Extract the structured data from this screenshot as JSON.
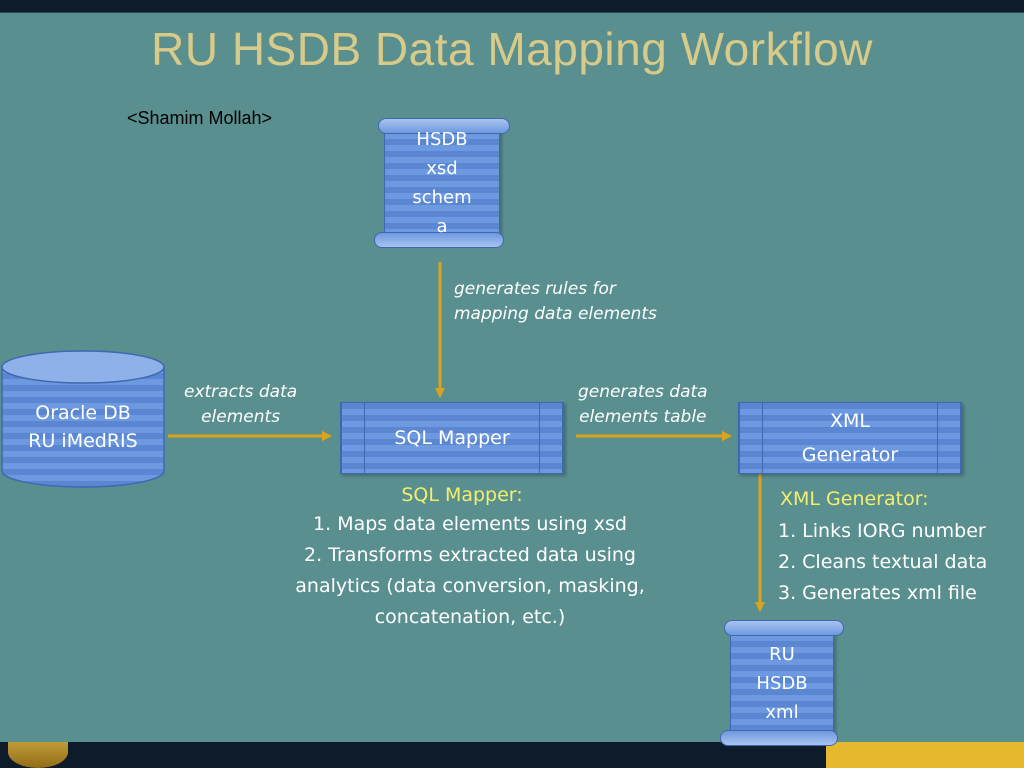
{
  "slide": {
    "title": "RU HSDB Data Mapping Workflow",
    "author": "<Shamim Mollah>"
  },
  "nodes": {
    "xsd_schema": {
      "label": "HSDB\nxsd\nschem\na"
    },
    "oracle_db": {
      "label": "Oracle DB\nRU iMedRIS"
    },
    "sql_mapper": {
      "label": "SQL Mapper"
    },
    "xml_generator": {
      "label": "XML\nGenerator"
    },
    "output_xml": {
      "label": "RU\nHSDB\nxml"
    }
  },
  "edges": {
    "schema_to_mapper": "generates rules for\nmapping  data elements",
    "db_to_mapper": "extracts data\nelements",
    "mapper_to_generator": "generates data\nelements table"
  },
  "sql_mapper_notes": {
    "title": "SQL Mapper:",
    "lines": [
      "1. Maps data elements using xsd",
      "2. Transforms extracted data using",
      "analytics (data conversion, masking,",
      "concatenation, etc.)"
    ]
  },
  "xml_generator_notes": {
    "title": "XML Generator:",
    "lines": [
      "1. Links IORG number",
      "2. Cleans textual data",
      "3. Generates xml file"
    ]
  },
  "colors": {
    "background": "#5a8f90",
    "title": "#d8ca88",
    "shape_fill": "#5b87d2",
    "arrow": "#d9a31c",
    "highlight_text": "#f2ef6d"
  }
}
